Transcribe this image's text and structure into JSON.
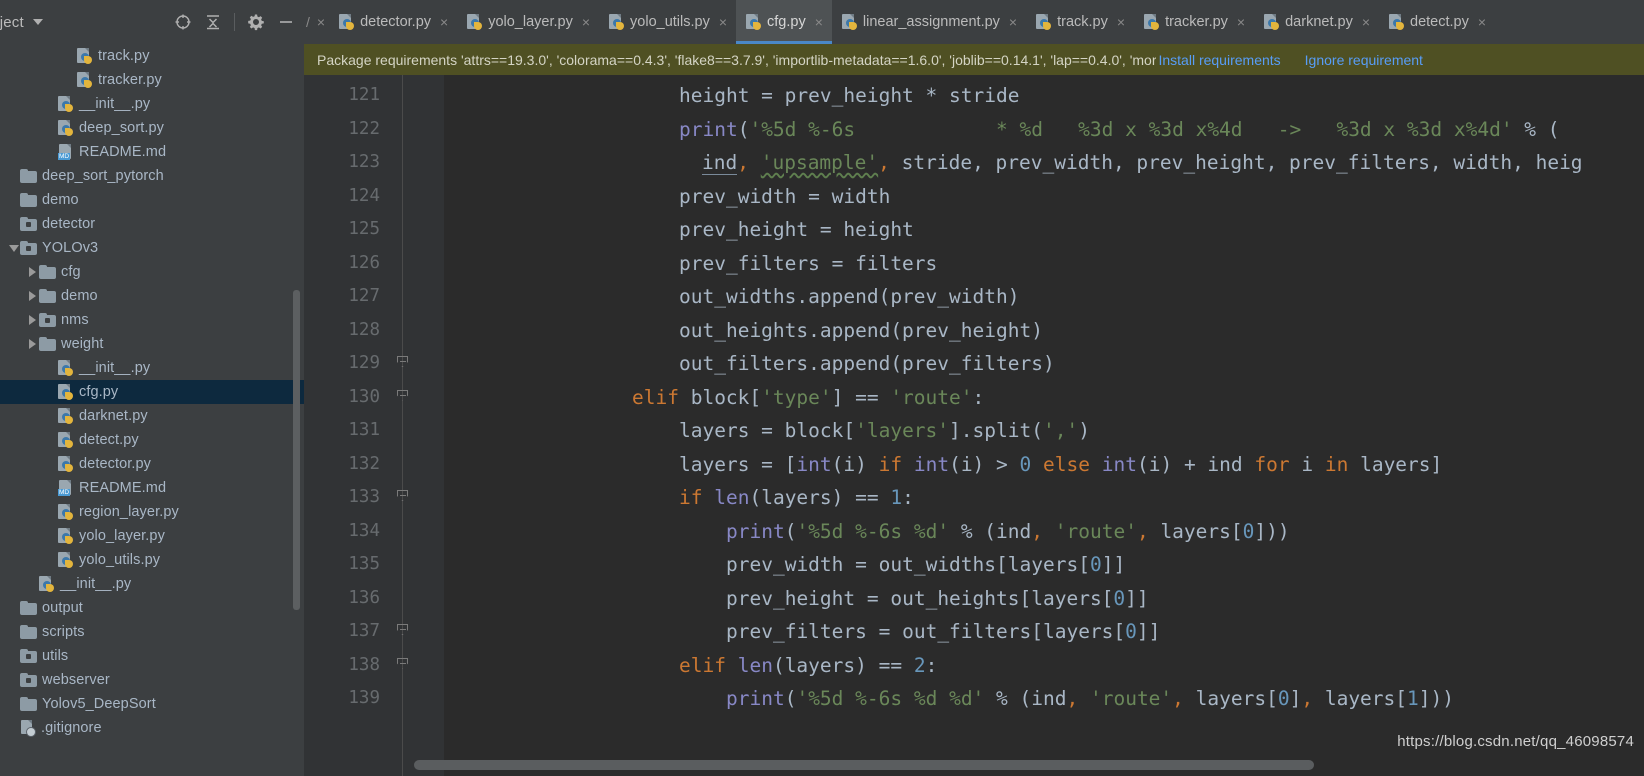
{
  "sidebar": {
    "title": "roject",
    "tools": [
      {
        "name": "locate-icon",
        "label": "Select Opened File"
      },
      {
        "name": "collapse-all-icon",
        "label": "Collapse All"
      },
      {
        "name": "gear-icon",
        "label": "Settings"
      },
      {
        "name": "minimize-icon",
        "label": "Hide"
      }
    ],
    "tree": [
      {
        "label": "track.py",
        "icon": "python-file-icon",
        "indent": 4,
        "twisty": "none",
        "selected": false
      },
      {
        "label": "tracker.py",
        "icon": "python-file-icon",
        "indent": 4,
        "twisty": "none",
        "selected": false
      },
      {
        "label": "__init__.py",
        "icon": "python-file-icon",
        "indent": 3,
        "twisty": "none",
        "selected": false
      },
      {
        "label": "deep_sort.py",
        "icon": "python-file-icon",
        "indent": 3,
        "twisty": "none",
        "selected": false
      },
      {
        "label": "README.md",
        "icon": "markdown-file-icon",
        "indent": 3,
        "twisty": "none",
        "selected": false
      },
      {
        "label": "deep_sort_pytorch",
        "icon": "folder-icon",
        "indent": 1,
        "twisty": "none",
        "selected": false
      },
      {
        "label": "demo",
        "icon": "folder-icon",
        "indent": 1,
        "twisty": "none",
        "selected": false
      },
      {
        "label": "detector",
        "icon": "source-folder-icon",
        "indent": 1,
        "twisty": "none",
        "selected": false
      },
      {
        "label": "YOLOv3",
        "icon": "source-folder-icon",
        "indent": 1,
        "twisty": "down",
        "selected": false
      },
      {
        "label": "cfg",
        "icon": "folder-icon",
        "indent": 2,
        "twisty": "right",
        "selected": false
      },
      {
        "label": "demo",
        "icon": "folder-icon",
        "indent": 2,
        "twisty": "right",
        "selected": false
      },
      {
        "label": "nms",
        "icon": "source-folder-icon",
        "indent": 2,
        "twisty": "right",
        "selected": false
      },
      {
        "label": "weight",
        "icon": "folder-icon",
        "indent": 2,
        "twisty": "right",
        "selected": false
      },
      {
        "label": "__init__.py",
        "icon": "python-file-icon",
        "indent": 3,
        "twisty": "none",
        "selected": false
      },
      {
        "label": "cfg.py",
        "icon": "python-file-icon",
        "indent": 3,
        "twisty": "none",
        "selected": true
      },
      {
        "label": "darknet.py",
        "icon": "python-file-icon",
        "indent": 3,
        "twisty": "none",
        "selected": false
      },
      {
        "label": "detect.py",
        "icon": "python-file-icon",
        "indent": 3,
        "twisty": "none",
        "selected": false
      },
      {
        "label": "detector.py",
        "icon": "python-file-icon",
        "indent": 3,
        "twisty": "none",
        "selected": false
      },
      {
        "label": "README.md",
        "icon": "markdown-file-icon",
        "indent": 3,
        "twisty": "none",
        "selected": false
      },
      {
        "label": "region_layer.py",
        "icon": "python-file-icon",
        "indent": 3,
        "twisty": "none",
        "selected": false
      },
      {
        "label": "yolo_layer.py",
        "icon": "python-file-icon",
        "indent": 3,
        "twisty": "none",
        "selected": false
      },
      {
        "label": "yolo_utils.py",
        "icon": "python-file-icon",
        "indent": 3,
        "twisty": "none",
        "selected": false
      },
      {
        "label": "__init__.py",
        "icon": "python-file-icon",
        "indent": 2,
        "twisty": "none",
        "selected": false
      },
      {
        "label": "output",
        "icon": "folder-icon",
        "indent": 1,
        "twisty": "none",
        "selected": false
      },
      {
        "label": "scripts",
        "icon": "folder-icon",
        "indent": 1,
        "twisty": "none",
        "selected": false
      },
      {
        "label": "utils",
        "icon": "source-folder-icon",
        "indent": 1,
        "twisty": "none",
        "selected": false
      },
      {
        "label": "webserver",
        "icon": "source-folder-icon",
        "indent": 1,
        "twisty": "none",
        "selected": false
      },
      {
        "label": "Yolov5_DeepSort",
        "icon": "folder-icon",
        "indent": 1,
        "twisty": "none",
        "selected": false
      },
      {
        "label": ".gitignore",
        "icon": "gitignore-file-icon",
        "indent": 1,
        "twisty": "none",
        "selected": false
      }
    ]
  },
  "tabs": {
    "leading_fragment": "/",
    "items": [
      {
        "label": "detector.py",
        "active": false
      },
      {
        "label": "yolo_layer.py",
        "active": false
      },
      {
        "label": "yolo_utils.py",
        "active": false
      },
      {
        "label": "cfg.py",
        "active": true
      },
      {
        "label": "linear_assignment.py",
        "active": false
      },
      {
        "label": "track.py",
        "active": false
      },
      {
        "label": "tracker.py",
        "active": false
      },
      {
        "label": "darknet.py",
        "active": false
      },
      {
        "label": "detect.py",
        "active": false
      }
    ],
    "close_glyph": "×"
  },
  "notification": {
    "message": "Package requirements 'attrs==19.3.0', 'colorama==0.4.3', 'flake8==3.7.9', 'importlib-metadata==1.6.0', 'joblib==0.14.1', 'lap==0.4.0', 'mor",
    "install_label": "Install requirements",
    "ignore_label": "Ignore requirement"
  },
  "editor": {
    "first_line": 121,
    "lines": [
      {
        "num": 121,
        "fold": "none"
      },
      {
        "num": 122,
        "fold": "none"
      },
      {
        "num": 123,
        "fold": "none"
      },
      {
        "num": 124,
        "fold": "none"
      },
      {
        "num": 125,
        "fold": "none"
      },
      {
        "num": 126,
        "fold": "none"
      },
      {
        "num": 127,
        "fold": "none"
      },
      {
        "num": 128,
        "fold": "none"
      },
      {
        "num": 129,
        "fold": "end"
      },
      {
        "num": 130,
        "fold": "end"
      },
      {
        "num": 131,
        "fold": "none"
      },
      {
        "num": 132,
        "fold": "none"
      },
      {
        "num": 133,
        "fold": "end"
      },
      {
        "num": 134,
        "fold": "none"
      },
      {
        "num": 135,
        "fold": "none"
      },
      {
        "num": 136,
        "fold": "none"
      },
      {
        "num": 137,
        "fold": "end"
      },
      {
        "num": 138,
        "fold": "end"
      },
      {
        "num": 139,
        "fold": "none"
      }
    ],
    "code": {
      "l121": "                    height = prev_height * stride",
      "l122_a": "                    print(",
      "l122_b": "'%5d %-6s            * %d   %3d x %3d x%4d   ->   %3d x %3d x%4d'",
      "l122_c": " % (",
      "l123_a": "                        ind",
      "l123_b": ", ",
      "l123_c": "'upsample'",
      "l123_d": ", stride, prev_width, prev_height, prev_filters, width, heig",
      "l124": "                    prev_width = width",
      "l125": "                    prev_height = height",
      "l126": "                    prev_filters = filters",
      "l127": "                    out_widths.append(prev_width)",
      "l128": "                    out_heights.append(prev_height)",
      "l129": "                    out_filters.append(prev_filters)",
      "l130_kw": "elif",
      "l130_mid": " block[",
      "l130_s1": "'type'",
      "l130_eq": "] == ",
      "l130_s2": "'route'",
      "l130_end": ":",
      "l131_a": "layers = block[",
      "l131_s": "'layers'",
      "l131_b": "].split(",
      "l131_s2": "','",
      "l131_c": ")",
      "l132_a": "layers = [",
      "l132_int1": "int",
      "l132_b": "(i) ",
      "l132_if": "if",
      "l132_int2": " int",
      "l132_c": "(i) > ",
      "l132_zero": "0",
      "l132_else": " else",
      "l132_int3": " int",
      "l132_d": "(i) + ind ",
      "l132_for": "for",
      "l132_e": " i ",
      "l132_in": "in",
      "l132_f": " layers]",
      "l133_if": "if",
      "l133_len": " len",
      "l133_a": "(layers) == ",
      "l133_n": "1",
      "l133_b": ":",
      "l134_p": "print",
      "l134_a": "(",
      "l134_s": "'%5d %-6s %d'",
      "l134_b": " % (ind, ",
      "l134_s2": "'route'",
      "l134_c": ", layers[",
      "l134_n": "0",
      "l134_d": "]))",
      "l135_a": "prev_width = out_widths[layers[",
      "l135_n": "0",
      "l135_b": "]]",
      "l136_a": "prev_height = out_heights[layers[",
      "l136_n": "0",
      "l136_b": "]]",
      "l137_a": "prev_filters = out_filters[layers[",
      "l137_n": "0",
      "l137_b": "]]",
      "l138_kw": "elif",
      "l138_len": " len",
      "l138_a": "(layers) == ",
      "l138_n": "2",
      "l138_b": ":",
      "l139_p": "print",
      "l139_a": "(",
      "l139_s": "'%5d %-6s %d %d'",
      "l139_b": " % (ind, ",
      "l139_s2": "'route'",
      "l139_c": ", layers[",
      "l139_n1": "0",
      "l139_d": "], layers[",
      "l139_n2": "1",
      "l139_e": "]))"
    }
  },
  "watermark": "https://blog.csdn.net/qq_46098574",
  "colors": {
    "accent": "#4a88c7",
    "selection": "#0d293e",
    "notification_bg": "#4f5023",
    "link": "#589df6",
    "editor_bg": "#2b2b2b",
    "gutter_bg": "#313335",
    "panel_bg": "#3c3f41",
    "keyword": "#cc7832",
    "string": "#6a8759",
    "number": "#6897bb",
    "function": "#8888c6",
    "text": "#a9b7c6"
  }
}
